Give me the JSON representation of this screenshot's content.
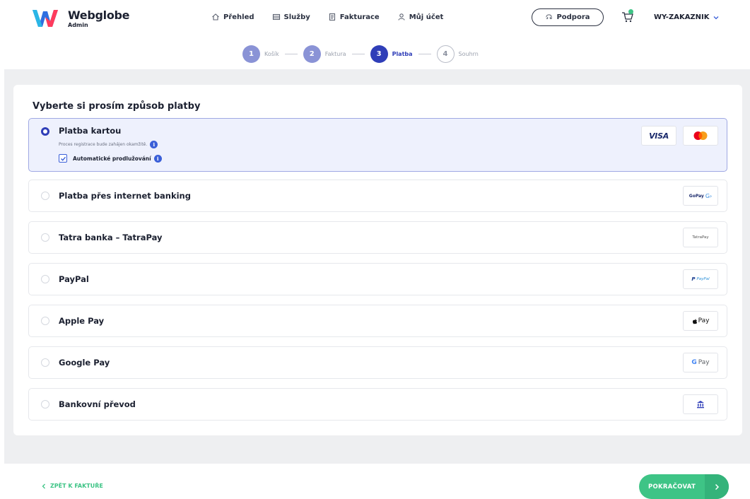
{
  "app": {
    "name": "Webglobe",
    "role": "Admin"
  },
  "nav": [
    {
      "label": "Přehled",
      "icon": "home-icon"
    },
    {
      "label": "Služby",
      "icon": "services-icon"
    },
    {
      "label": "Fakturace",
      "icon": "invoice-icon"
    },
    {
      "label": "Můj účet",
      "icon": "user-icon"
    }
  ],
  "header": {
    "support_label": "Podpora",
    "account_label": "WY-ZAKAZNIK"
  },
  "steps": [
    {
      "num": "1",
      "label": "Košík",
      "state": "done"
    },
    {
      "num": "2",
      "label": "Faktura",
      "state": "done"
    },
    {
      "num": "3",
      "label": "Platba",
      "state": "active"
    },
    {
      "num": "4",
      "label": "Souhrn",
      "state": "todo"
    }
  ],
  "payment": {
    "title": "Vyberte si prosím způsob platby",
    "card": {
      "label": "Platba kartou",
      "sub": "Proces registrace bude zahájen okamžitě.",
      "auto_renew": "Automatické prodlužování",
      "logos": [
        "VISA",
        "Mastercard"
      ]
    },
    "options": [
      {
        "label": "Platba přes internet banking",
        "logo": "GoPay",
        "logo_text": "GoPay"
      },
      {
        "label": "Tatra banka – TatraPay",
        "logo": "TatraPay",
        "logo_text": "TatraPay"
      },
      {
        "label": "PayPal",
        "logo": "PayPal",
        "logo_text": "PayPal"
      },
      {
        "label": "Apple Pay",
        "logo": "Apple Pay",
        "logo_text": "Pay"
      },
      {
        "label": "Google Pay",
        "logo": "Google Pay",
        "logo_text": "Pay"
      },
      {
        "label": "Bankovní převod",
        "logo": "bank-icon",
        "logo_text": ""
      }
    ]
  },
  "footer": {
    "back_label": "ZPĚT K FAKTUŘE",
    "continue_label": "POKRAČOVAT"
  },
  "colors": {
    "accent": "#2f3eb8",
    "green": "#3ec486",
    "selected_bg": "#eef1fd"
  }
}
